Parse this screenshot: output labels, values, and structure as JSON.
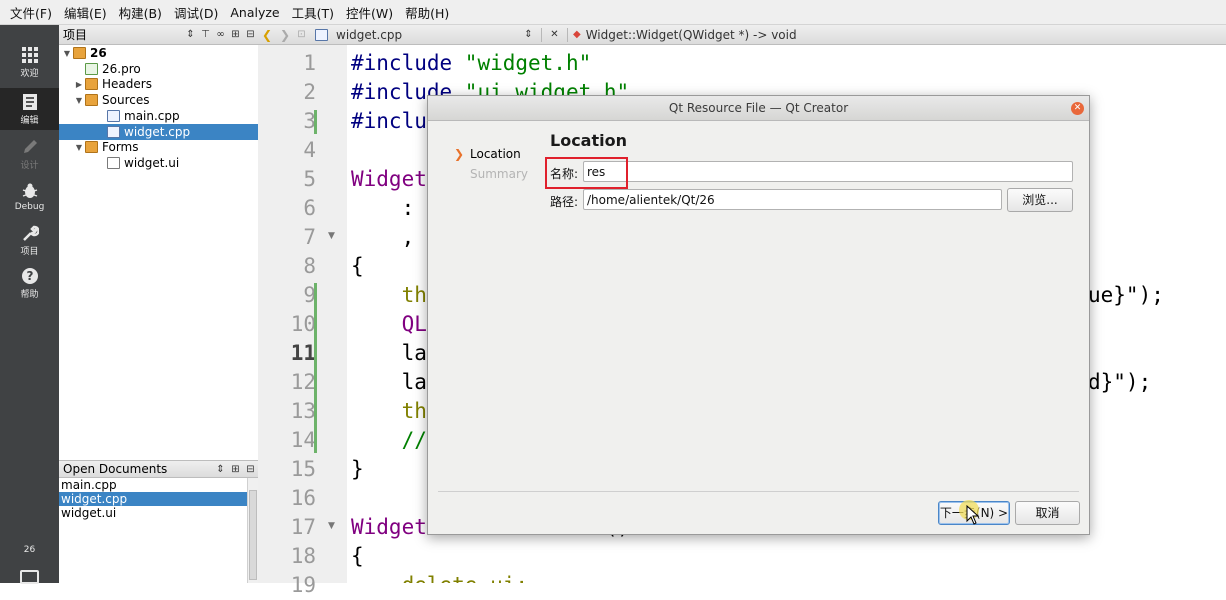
{
  "menubar": [
    "文件(F)",
    "编辑(E)",
    "构建(B)",
    "调试(D)",
    "Analyze",
    "工具(T)",
    "控件(W)",
    "帮助(H)"
  ],
  "modes": {
    "welcome": "欢迎",
    "edit": "编辑",
    "design": "设计",
    "debug": "Debug",
    "projects": "项目",
    "help": "帮助",
    "kit": "26"
  },
  "project_pane": {
    "title": "项目",
    "tree": [
      {
        "label": "26",
        "icon": "project-icon"
      },
      {
        "label": "26.pro",
        "icon": "pro-file-icon"
      },
      {
        "label": "Headers",
        "icon": "folder-icon"
      },
      {
        "label": "Sources",
        "icon": "folder-icon"
      },
      {
        "label": "main.cpp",
        "icon": "cpp-file-icon"
      },
      {
        "label": "widget.cpp",
        "icon": "cpp-file-icon"
      },
      {
        "label": "Forms",
        "icon": "folder-icon"
      },
      {
        "label": "widget.ui",
        "icon": "ui-file-icon"
      }
    ]
  },
  "open_documents": {
    "title": "Open Documents",
    "items": [
      "main.cpp",
      "widget.cpp",
      "widget.ui"
    ]
  },
  "editor": {
    "file_name": "widget.cpp",
    "function_signature": "Widget::Widget(QWidget *) -> void",
    "line_numbers": [
      "1",
      "2",
      "3",
      "4",
      "5",
      "6",
      "7",
      "8",
      "9",
      "10",
      "11",
      "12",
      "13",
      "14",
      "15",
      "16",
      "17",
      "18",
      "19"
    ],
    "current_line": "11",
    "lines": {
      "l1a": "#include ",
      "l1b": "\"widget.h\"",
      "l2a": "#include ",
      "l2b": "\"ui_widget.h\"",
      "l3": "#inclu",
      "l5": "Widget",
      "l6": "    :",
      "l7": "    ,",
      "l8": "{",
      "l9": "    th",
      "l9r": "ue}\");",
      "l10": "    QL",
      "l11": "    la",
      "l12": "    la",
      "l12r": "d}\");",
      "l13": "    th",
      "l14": "    //",
      "l15": "}",
      "l17a": "Widget",
      "l17b": "   ()",
      "l18": "{",
      "l19": "    delete ui;"
    }
  },
  "dialog": {
    "title": "Qt Resource File — Qt Creator",
    "steps": [
      "Location",
      "Summary"
    ],
    "page_title": "Location",
    "name_label": "名称:",
    "name_value": "res",
    "path_label": "路径:",
    "path_value": "/home/alientek/Qt/26",
    "browse_button": "浏览...",
    "next_button": "下一步(N) >",
    "cancel_button": "取消"
  }
}
